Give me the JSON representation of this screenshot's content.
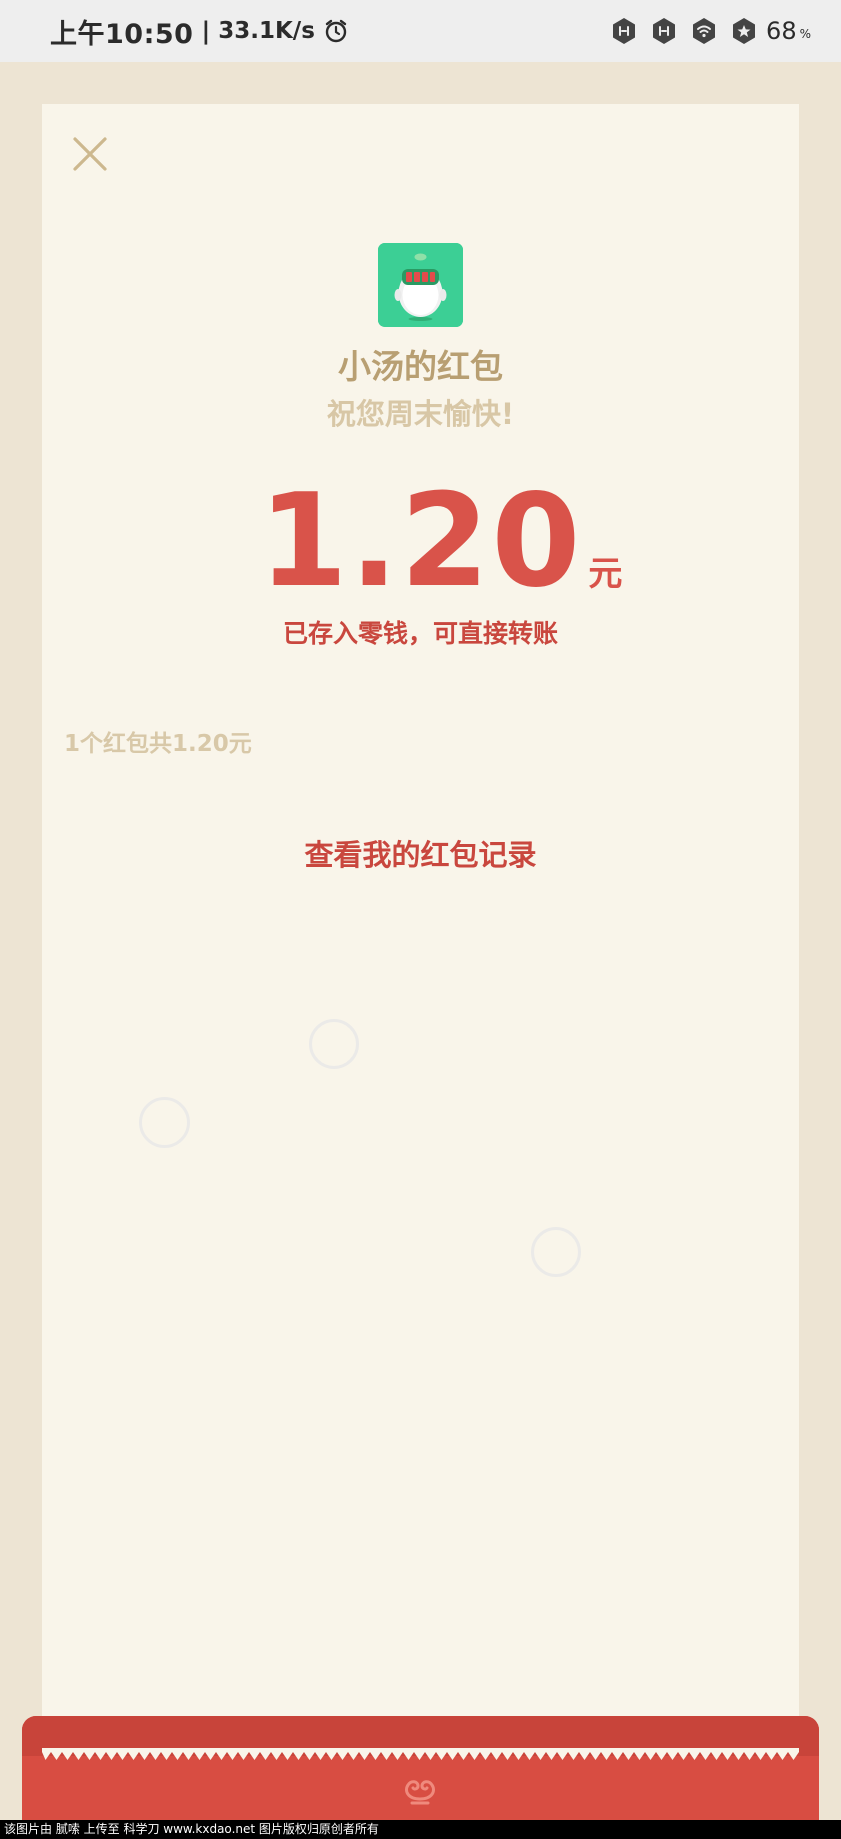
{
  "status_bar": {
    "time": "上午10:50",
    "separator": "|",
    "network_speed": "33.1K/s",
    "battery_level": "68",
    "battery_unit": "%",
    "icons": [
      "alarm-icon",
      "hd-signal-icon",
      "hd-signal-icon",
      "wifi-icon",
      "battery-saver-icon"
    ]
  },
  "red_packet": {
    "sender_title": "小汤的红包",
    "greeting": "祝您周末愉快!",
    "amount": "1.20",
    "amount_unit": "元",
    "stored_note": "已存入零钱，可直接转账",
    "summary": "1个红包共1.20元",
    "record_link": "查看我的红包记录"
  },
  "watermark": "该图片由  腻嗦  上传至  科学刀  www.kxdao.net  图片版权归原创者所有",
  "colors": {
    "accent_red": "#d9534a",
    "gold": "#b89f72",
    "card_bg": "#f9f5ea",
    "page_bg": "#ede4d3",
    "app_icon_green": "#3ccf95"
  }
}
